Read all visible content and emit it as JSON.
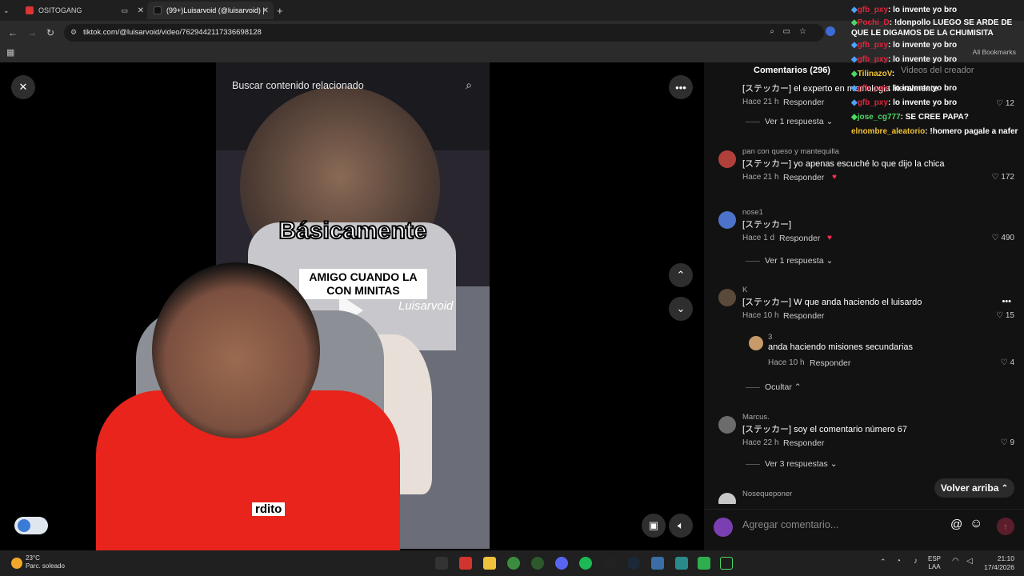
{
  "browser": {
    "tabs": [
      {
        "label": "OSITOGANG"
      },
      {
        "label": "(99+)Luisarvoid (@luisarvoid) |"
      }
    ],
    "url": "tiktok.com/@luisarvoid/video/7629442117336698128",
    "bookmarks_label": "All Bookmarks"
  },
  "video": {
    "search_placeholder": "Buscar contenido relacionado",
    "overlay_title": "Básicamente",
    "caption": "AMIGO CUANDO LA CON MINITAS",
    "watermark": "Luisarvoid",
    "bottom_word": "rdito"
  },
  "panel": {
    "tab_comments": "Comentarios (296)",
    "tab_creator_videos": "Videos del creador",
    "reply_label": "Responder",
    "back_to_top": "Volver arriba",
    "add_comment_placeholder": "Agregar comentario...",
    "comments": [
      {
        "user": "",
        "text": "[ステッカー] el experto en momologia literalmente",
        "time": "Hace 21 h",
        "likes": "12",
        "view_replies": "Ver 1 respuesta"
      },
      {
        "user": "pan con queso y mantequilla",
        "text": "[ステッカー] yo apenas escuché lo que dijo la chica",
        "time": "Hace 21 h",
        "likes": "172",
        "view_replies": ""
      },
      {
        "user": "nose1",
        "text": "[ステッカー]",
        "time": "Hace 1 d",
        "likes": "490",
        "view_replies": "Ver 1 respuesta"
      },
      {
        "user": "K",
        "text": "[ステッカー] W que anda haciendo el luisardo",
        "time": "Hace 10 h",
        "likes": "15",
        "view_replies": ""
      },
      {
        "user": "3",
        "text": "anda haciendo misiones secundarias",
        "time": "Hace 10 h",
        "likes": "4",
        "view_replies": "Ocultar"
      },
      {
        "user": "Marcus.",
        "text": "[ステッカー] soy el comentario número 67",
        "time": "Hace 22 h",
        "likes": "9",
        "view_replies": "Ver 3 respuestas"
      },
      {
        "user": "Nosequeponer",
        "text": "",
        "time": "",
        "likes": "",
        "view_replies": ""
      }
    ]
  },
  "chat": [
    {
      "user": "gfb_pxy",
      "msg": ": lo invente yo bro"
    },
    {
      "user": "Pochi_D",
      "msg": ": !donpollo LUEGO SE ARDE DE QUE LE DIGAMOS DE LA CHUMISITA"
    },
    {
      "user": "gfb_pxy",
      "msg": ": lo invente yo bro"
    },
    {
      "user": "gfb_pxy",
      "msg": ": lo invente yo bro"
    },
    {
      "user": "TilinazoV",
      "msg": ":"
    },
    {
      "user": "gfb_pxy",
      "msg": ": lo invente yo bro"
    },
    {
      "user": "gfb_pxy",
      "msg": ": lo invente yo bro"
    },
    {
      "user": "jose_cg777",
      "msg": ": SE CREE PAPA?"
    },
    {
      "user": "elnombre_aleatorio",
      "msg": ": !homero pagale a nafer"
    }
  ],
  "taskbar": {
    "weather_temp": "23°C",
    "weather_desc": "Parc. soleado",
    "lang_1": "ESP",
    "lang_2": "LAA",
    "time": "21:10",
    "date": "17/4/2026"
  },
  "colors": {
    "accent_red": "#fe2c55",
    "panel_bg": "#121212",
    "chat_user_red": "#e0243a"
  }
}
